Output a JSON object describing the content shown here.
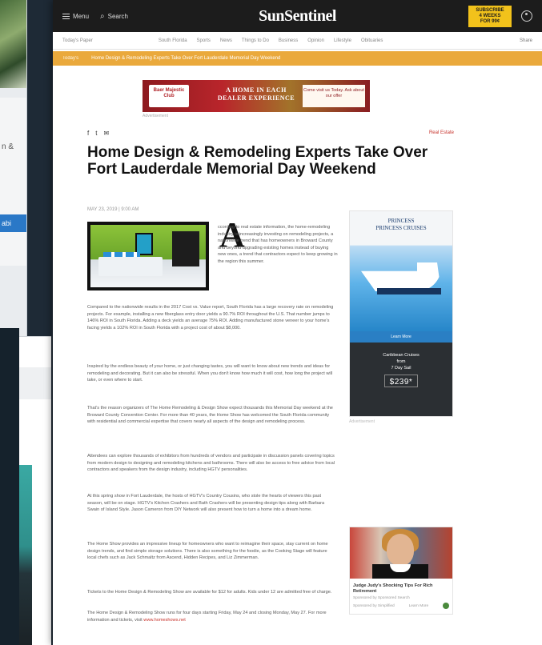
{
  "background": {
    "partial_text": "n &",
    "partial_button": "abi"
  },
  "site": {
    "brand": "SunSentinel",
    "menu_label": "Menu",
    "search_label": "Search",
    "subscribe_label": "SUBSCRIBE 4 WEEKS FOR 99¢"
  },
  "sections_bar": {
    "left": "Today's Paper",
    "items": [
      "South Florida",
      "Sports",
      "News",
      "Things to Do",
      "Business",
      "Opinion",
      "Lifestyle",
      "Obituaries"
    ],
    "right": "Share"
  },
  "alert": {
    "tag": "Today's",
    "text": "Home Design & Remodeling Experts Take Over Fort Lauderdale Memorial Day Weekend"
  },
  "ad_banner": {
    "logo": "Baer Majestic Club",
    "headline": "A HOME IN EACH DEALER EXPERIENCE",
    "cta": "Come visit us Today. Ask about our offer",
    "caption": "Advertisement"
  },
  "article": {
    "share_icons": [
      "f",
      "t",
      "✉"
    ],
    "section_label": "Real Estate",
    "headline": "Home Design & Remodeling Experts Take Over Fort Lauderdale Memorial Day Weekend",
    "byline": "MAY 23, 2019 | 9:00 AM",
    "dropcap": "A",
    "paragraphs": [
      "ccording to real estate information, the home-remodeling industry is increasingly investing on remodeling projects, a nationwide trend that has homeowners in Broward County and beyond upgrading existing homes instead of buying new ones, a trend that contractors expect to keep growing in the region this summer.",
      "Compared to the nationwide results in the 2017 Cost vs. Value report, South Florida has a large recovery rate on remodeling projects. For example, installing a new fiberglass entry door yields a 90.7% ROI throughout the U.S. That number jumps to 146% ROI in South Florida. Adding a deck yields an average 75% ROI. Adding manufactured stone veneer to your home's facing yields a 102% ROI in South Florida with a project cost of about $8,000.",
      "Inspired by the endless beauty of your home, or just changing tastes, you will want to know about new trends and ideas for remodeling and decorating. But it can also be stressful. When you don't know how much it will cost, how long the project will take, or even where to start.",
      "That's the reason organizers of The Home Remodeling & Design Show expect thousands this Memorial Day weekend at the Broward County Convention Center. For more than 40 years, the Home Show has welcomed the South Florida community with residential and commercial expertise that covers nearly all aspects of the design and remodeling process.",
      "Attendees can explore thousands of exhibitors from hundreds of vendors and participate in discussion panels covering topics from modern design to designing and remodeling kitchens and bathrooms. There will also be access to free advice from local contractors and speakers from the design industry, including HGTV personalities.",
      "At this spring show in Fort Lauderdale, the hosts of HGTV's Country Cousins, who stole the hearts of viewers this past season, will be on stage. HGTV's Kitchen Crashers and Bath Crashers will be presenting design tips along with Barbara Swain of Island Style. Jason Cameron from DIY Network will also present how to turn a home into a dream home.",
      "The Home Show provides an impressive lineup for homeowners who want to reimagine their space, stay current on home design trends, and find simple storage solutions. There is also something for the foodie, as the Cooking Stage will feature local chefs such as Jack Schmaltz from Ascend, Hidden Recipes, and Liz Zimmerman.",
      "Tickets to the Home Design & Remodeling Show are available for $12 for adults. Kids under 12 are admitted free of charge.",
      "The Home Design & Remodeling Show runs for four days starting Friday, May 24 and closing Monday, May 27. For more information and tickets, visit"
    ],
    "link_text": "www.homeshows.net"
  },
  "rail_ad": {
    "logo_line1": "PRINCESS",
    "logo_line2": "PRINCESS CRUISES",
    "mid_text": "Learn More",
    "body_line1": "Caribbean Cruises",
    "body_line2": "from",
    "body_line3": "7 Day Sail",
    "price": "$239*",
    "caption": "Advertisement"
  },
  "rail_ad2": {
    "title": "Judge Judy's Shocking Tips For Rich Retirement",
    "sub": "Sponsored by Sponsored Search",
    "foot_left": "Sponsored by Simplified",
    "foot_right": "Learn More"
  }
}
